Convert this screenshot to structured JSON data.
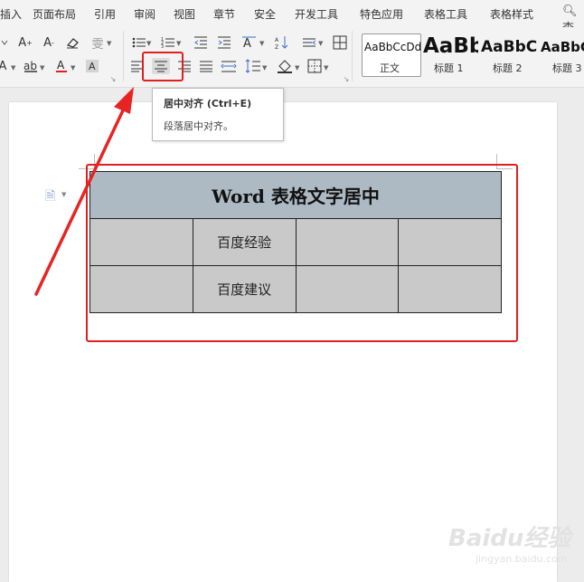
{
  "menu": {
    "items": [
      "插入",
      "页面布局",
      "引用",
      "审阅",
      "视图",
      "章节",
      "安全",
      "开发工具",
      "特色应用",
      "表格工具",
      "表格样式"
    ],
    "insert_partial": "插入",
    "search_partial": "查"
  },
  "ribbon": {
    "left_partial_glyph": "A",
    "styles": [
      {
        "sample": "AaBbCcDd",
        "name": "正文"
      },
      {
        "sample": "AaBb",
        "name": "标题 1"
      },
      {
        "sample": "AaBbC",
        "name": "标题 2"
      },
      {
        "sample": "AaBbC",
        "name": "标题 3"
      }
    ],
    "icons": [
      "font-size-increase-icon",
      "font-size-decrease-icon",
      "clear-format-icon",
      "phonetic-guide-icon",
      "text-effect-icon",
      "highlight-icon",
      "font-color-icon",
      "char-shading-icon",
      "bullet-list-icon",
      "numbered-list-icon",
      "decrease-indent-icon",
      "increase-indent-icon",
      "char-scale-icon",
      "sort-icon",
      "show-marks-icon",
      "table-props-icon",
      "align-left-icon",
      "align-center-icon",
      "align-right-icon",
      "justify-icon",
      "distributed-icon",
      "line-spacing-icon",
      "shading-icon",
      "borders-icon"
    ]
  },
  "tooltip": {
    "title": "居中对齐 (Ctrl+E)",
    "description": "段落居中对齐。"
  },
  "document": {
    "table": {
      "header": "Word 表格文字居中",
      "rows": [
        [
          "",
          "百度经验",
          "",
          ""
        ],
        [
          "",
          "百度建议",
          "",
          ""
        ]
      ]
    }
  },
  "annotation": {
    "highlight_color": "#e02020"
  },
  "watermark": {
    "brand": "Baidu经验",
    "url": "jingyan.baidu.com"
  }
}
